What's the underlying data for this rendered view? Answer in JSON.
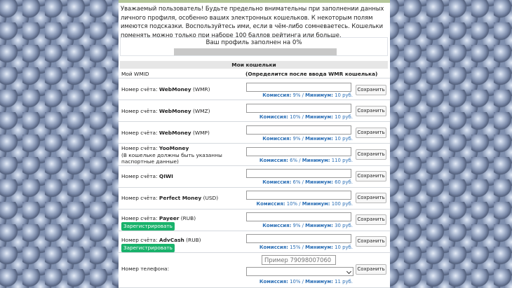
{
  "notice": "Уважаемый пользователь! Будьте предельно внимательны при заполнении данных личного профиля, особенно ваших электронных кошельков. К некоторым полям имеются подсказки. Воспользуйтесь ими, если в чём-либо сомневаетесь. Кошельки поменять можно только при наборе 100 баллов рейтинга или больше.",
  "profile": {
    "label": "Ваш профиль заполнен на 0%",
    "percent": 0
  },
  "section_title": "Мои кошельки",
  "wmid": {
    "label": "Мой WMID",
    "value": "(Определится после ввода WMR кошелька)"
  },
  "common": {
    "account_prefix": "Номер счёта:",
    "fee_label": "Комиссия:",
    "min_label": "Минимум:",
    "save_label": "Сохранить",
    "register_label": "Зарегистрировать"
  },
  "wallets": [
    {
      "brand": "WebMoney",
      "suffix": "(WMR)",
      "fee": "9%",
      "min": "10 руб."
    },
    {
      "brand": "WebMoney",
      "suffix": "(WMZ)",
      "fee": "10%",
      "min": "10 руб."
    },
    {
      "brand": "WebMoney",
      "suffix": "(WMP)",
      "fee": "9%",
      "min": "10 руб."
    },
    {
      "brand": "YooMoney",
      "note": "(В кошельке должны быть указанны паспортные данные)",
      "fee": "6%",
      "min": "110 руб."
    },
    {
      "brand": "QIWI",
      "fee": "6%",
      "min": "60 руб."
    },
    {
      "brand": "Perfect Money",
      "suffix": "(USD)",
      "fee": "10%",
      "min": "100 руб."
    },
    {
      "brand": "Payeer",
      "suffix": "(RUB)",
      "fee": "9%",
      "min": "30 руб."
    },
    {
      "brand": "AdvCash",
      "suffix": "(RUB)",
      "fee": "15%",
      "min": "10 руб."
    }
  ],
  "phone": {
    "label": "Номер телефона:",
    "placeholder": "Пример 79098007060",
    "fee": "10%",
    "min": "11 руб."
  }
}
